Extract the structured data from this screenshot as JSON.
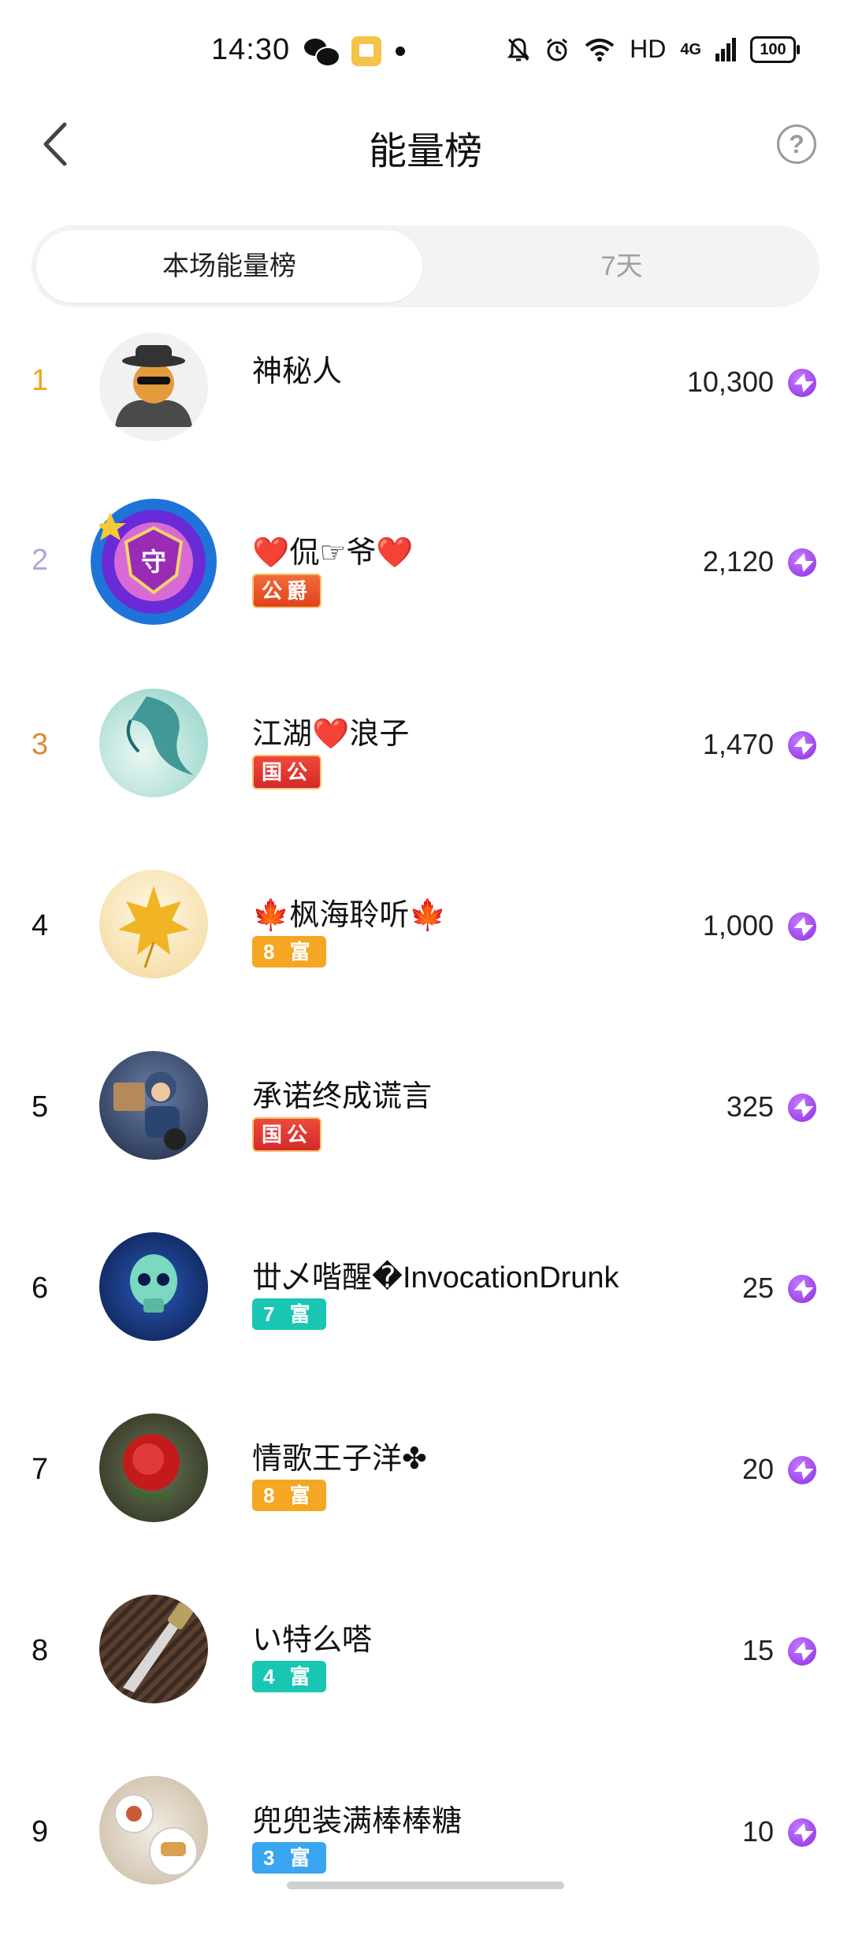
{
  "status_bar": {
    "time": "14:30",
    "hd": "HD",
    "network": "4G",
    "battery": "100",
    "icons": [
      "wechat-icon",
      "app-notification-icon",
      "notification-dot",
      "mute-bell-icon",
      "alarm-icon",
      "wifi-icon",
      "signal-icon",
      "battery-icon"
    ]
  },
  "header": {
    "title": "能量榜",
    "back_icon": "chevron-left-icon",
    "help_label": "?"
  },
  "tabs": [
    {
      "label": "本场能量榜",
      "active": true
    },
    {
      "label": "7天",
      "active": false
    }
  ],
  "rank_colors": {
    "1": "#f2a51b",
    "2": "#a9a9d6",
    "3": "#d8893a",
    "default": "#111111"
  },
  "leaderboard": [
    {
      "rank": "1",
      "name": "神秘人",
      "badge": "",
      "score": "10,300"
    },
    {
      "rank": "2",
      "name": "❤️侃☞爷❤️",
      "badge": "公爵",
      "badge_type": "noble",
      "score": "2,120"
    },
    {
      "rank": "3",
      "name": "江湖❤️浪子",
      "badge": "国公",
      "badge_type": "noble",
      "score": "1,470"
    },
    {
      "rank": "4",
      "name": "🍁枫海聆听🍁",
      "badge": "8 富",
      "badge_type": "rich",
      "badge_color": "#f5a623",
      "score": "1,000"
    },
    {
      "rank": "5",
      "name": "承诺终成谎言",
      "badge": "国公",
      "badge_type": "noble",
      "score": "325"
    },
    {
      "rank": "6",
      "name": "丗乄喈醒�InvocationDrunk",
      "badge": "7 富",
      "badge_type": "rich",
      "badge_color": "#19c6b4",
      "score": "25"
    },
    {
      "rank": "7",
      "name": "情歌王子洋✤",
      "badge": "8 富",
      "badge_type": "rich",
      "badge_color": "#f5a623",
      "score": "20"
    },
    {
      "rank": "8",
      "name": "い特么嗒",
      "badge": "4 富",
      "badge_type": "rich",
      "badge_color": "#19c6b4",
      "score": "15"
    },
    {
      "rank": "9",
      "name": "兜兜装满棒棒糖",
      "badge": "3 富",
      "badge_type": "rich",
      "badge_color": "#3aa5f0",
      "score": "10"
    }
  ],
  "energy_icon": "lightning-energy-icon"
}
